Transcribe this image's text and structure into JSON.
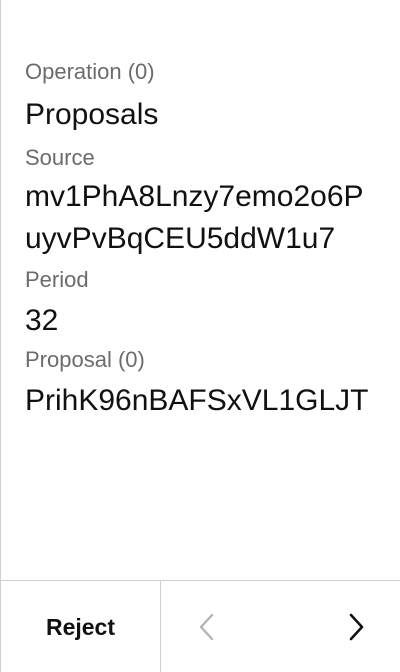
{
  "fields": [
    {
      "label": "Operation (0)",
      "value": "Proposals"
    },
    {
      "label": "Source",
      "value": "mv1PhA8Lnzy7emo2o6PuyvPvBqCEU5ddW1u7"
    },
    {
      "label": "Period",
      "value": "32"
    },
    {
      "label": "Proposal (0)",
      "value": "PrihK96nBAFSxVL1GLJT"
    }
  ],
  "footer": {
    "reject_label": "Reject",
    "prev_icon": "chevron-left-icon",
    "next_icon": "chevron-right-icon",
    "prev_enabled": false,
    "next_enabled": true
  },
  "colors": {
    "label": "#6b6b6b",
    "value": "#111111",
    "divider": "#cfcfcf",
    "disabled_icon": "#b5b5b5",
    "enabled_icon": "#111111"
  }
}
